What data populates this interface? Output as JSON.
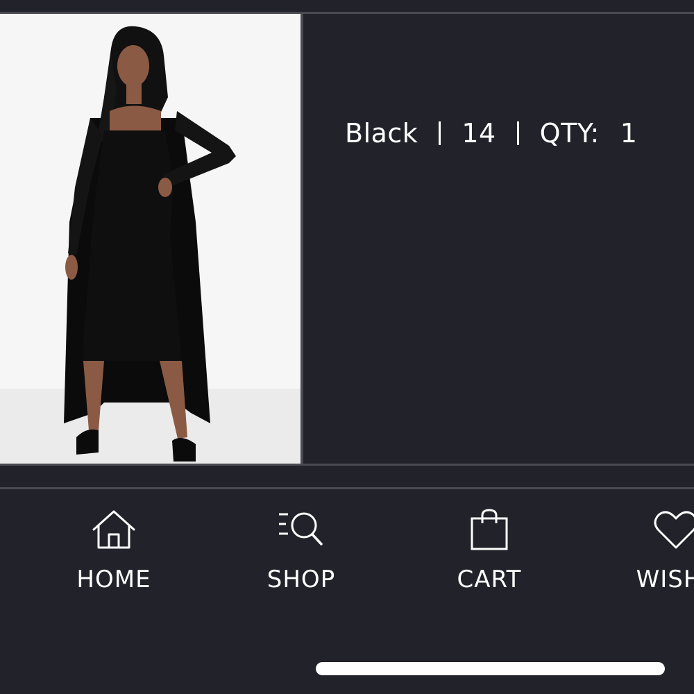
{
  "product": {
    "color": "Black",
    "size": "14",
    "qty_label": "QTY:",
    "qty_value": "1"
  },
  "bottom_nav": {
    "items": [
      {
        "label": "HOME",
        "icon": "home-icon"
      },
      {
        "label": "SHOP",
        "icon": "search-icon"
      },
      {
        "label": "CART",
        "icon": "shopping-bag-icon"
      },
      {
        "label": "WISHL",
        "icon": "heart-icon"
      }
    ]
  },
  "colors": {
    "background": "#22232a",
    "divider": "#4a4b52",
    "text": "#ffffff",
    "image_background": "#f5f5f5"
  }
}
